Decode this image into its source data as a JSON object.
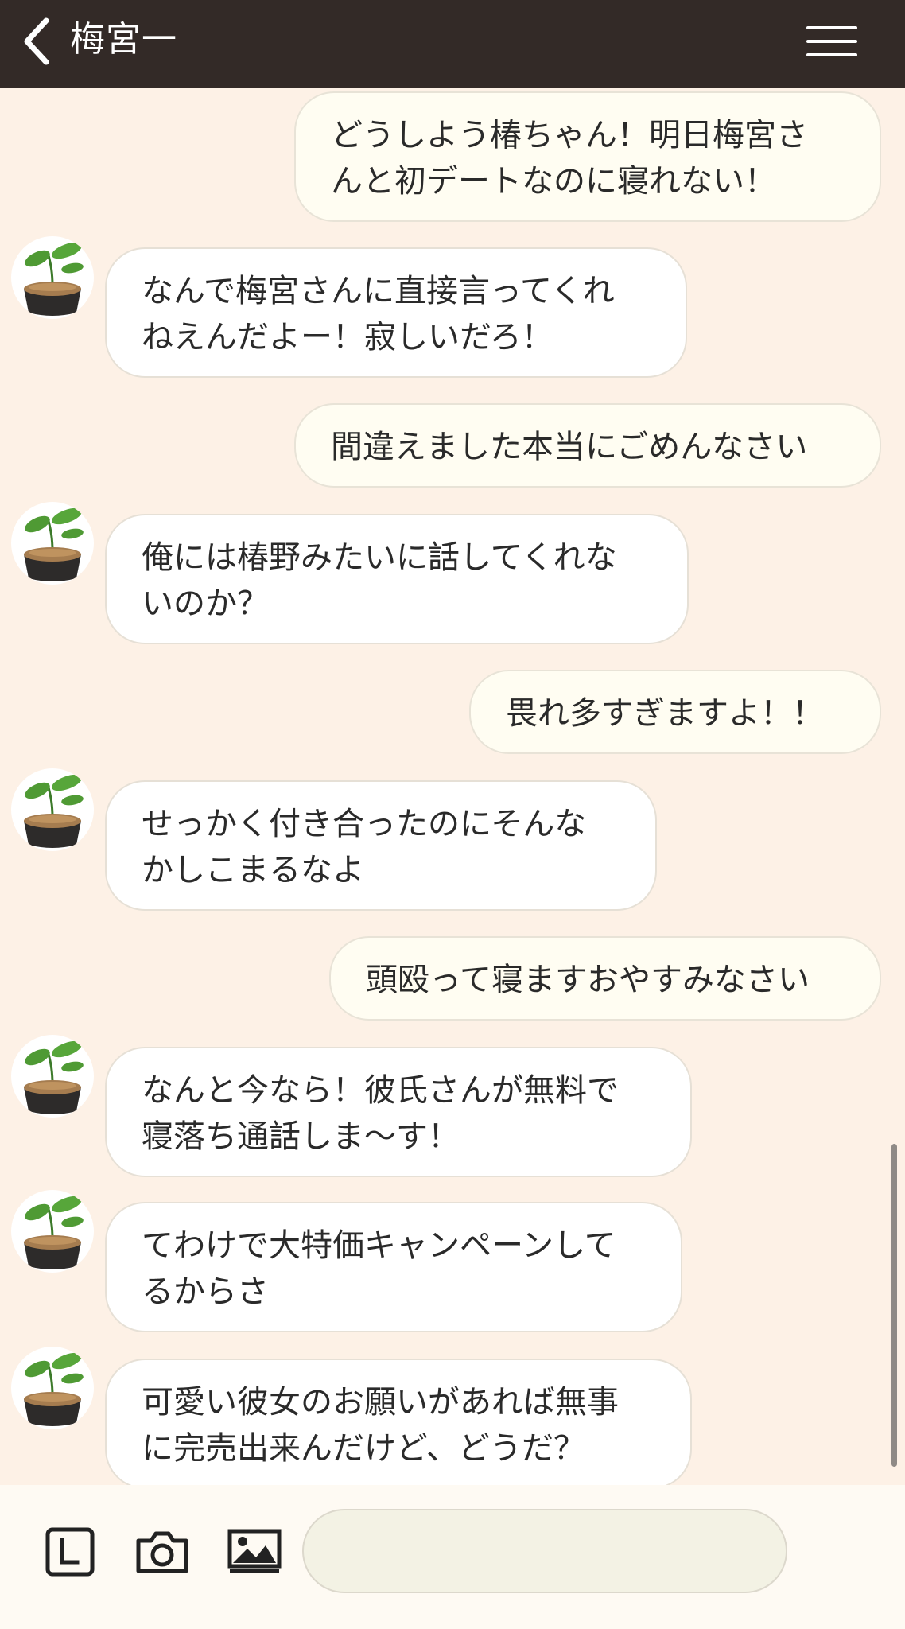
{
  "header": {
    "back_icon": "chevron-left-icon",
    "title": "梅宮一",
    "menu_icon": "hamburger-menu-icon"
  },
  "contact": {
    "avatar_icon": "sprout-plant-icon"
  },
  "messages": [
    {
      "side": "sent",
      "text": "どうしよう椿ちゃん！明日梅宮さ\nんと初デートなのに寝れない！"
    },
    {
      "side": "received",
      "text": "なんで梅宮さんに直接言ってくれ\nねえんだよー！寂しいだろ！"
    },
    {
      "side": "sent",
      "text": "間違えました本当にごめんなさい"
    },
    {
      "side": "received",
      "text": "俺には椿野みたいに話してくれな\nいのか？"
    },
    {
      "side": "sent",
      "text": "畏れ多すぎますよ！！"
    },
    {
      "side": "received",
      "text": "せっかく付き合ったのにそんな\nかしこまるなよ"
    },
    {
      "side": "sent",
      "text": "頭殴って寝ますおやすみなさい"
    },
    {
      "side": "received",
      "text": "なんと今なら！彼氏さんが無料で\n寝落ち通話しま〜す！"
    },
    {
      "side": "received",
      "text": "てわけで大特価キャンペーンして\nるからさ"
    },
    {
      "side": "received",
      "text": "可愛い彼女のお願いがあれば無事\nに完売出来んだけど、どうだ？"
    }
  ],
  "input_bar": {
    "icons": [
      "line-keyboard-icon",
      "camera-icon",
      "image-icon"
    ],
    "message_value": "",
    "message_placeholder": ""
  },
  "colors": {
    "header_bg": "#332a27",
    "chat_bg": "#fdf1e6",
    "sent_bubble": "#fffdf2",
    "received_bubble": "#ffffff",
    "input_bar_bg": "#fefaf3"
  }
}
